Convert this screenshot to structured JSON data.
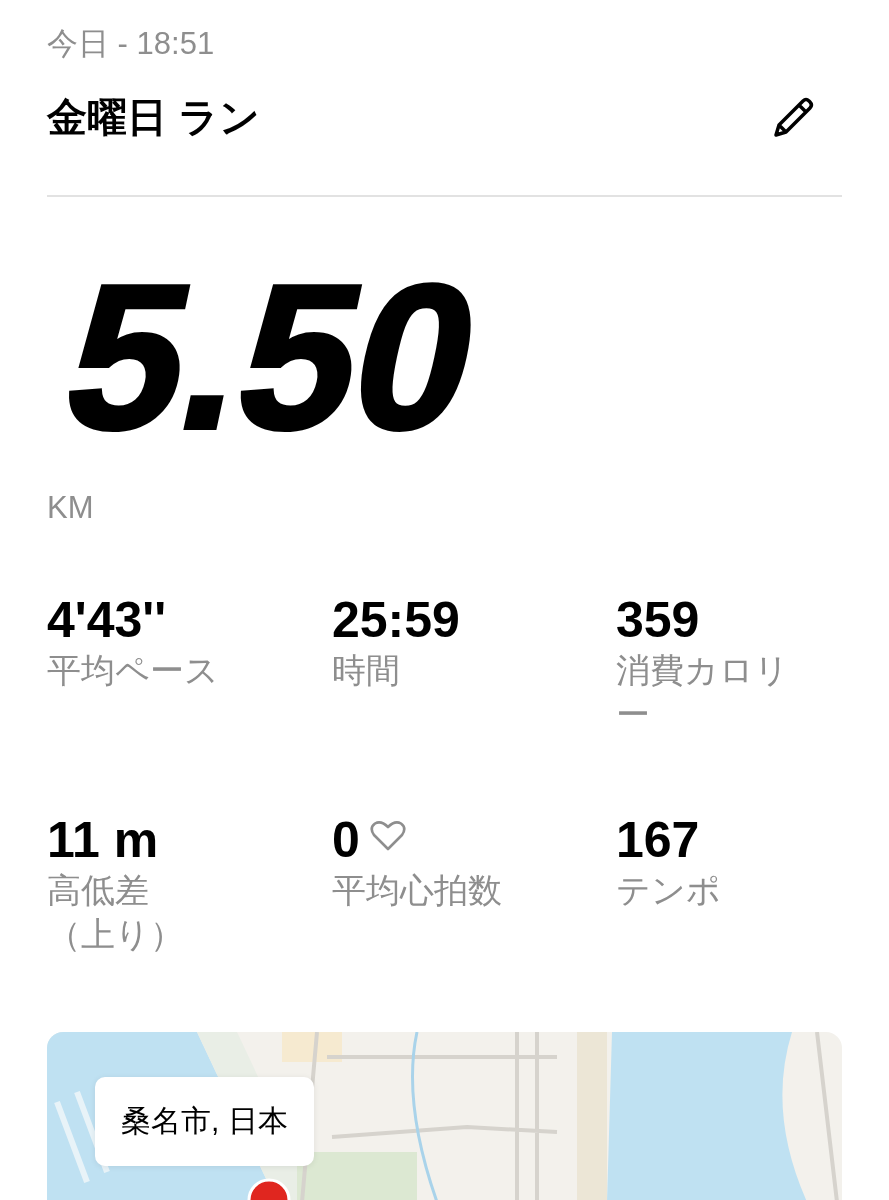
{
  "header": {
    "date": "今日 - 18:51",
    "title": "金曜日 ラン"
  },
  "distance": {
    "value": "5.50",
    "unit": "KM"
  },
  "stats": [
    {
      "kind": "plain",
      "value": "4'43''",
      "label": "平均ペース"
    },
    {
      "kind": "plain",
      "value": "25:59",
      "label": "時間"
    },
    {
      "kind": "plain",
      "value": "359",
      "label": "消費カロリー"
    },
    {
      "kind": "plain",
      "value": "11 m",
      "label": "高低差（上り）"
    },
    {
      "kind": "heart",
      "value": "0",
      "label": "平均心拍数"
    },
    {
      "kind": "plain",
      "value": "167",
      "label": "テンポ"
    }
  ],
  "map": {
    "location": "桑名市, 日本"
  }
}
